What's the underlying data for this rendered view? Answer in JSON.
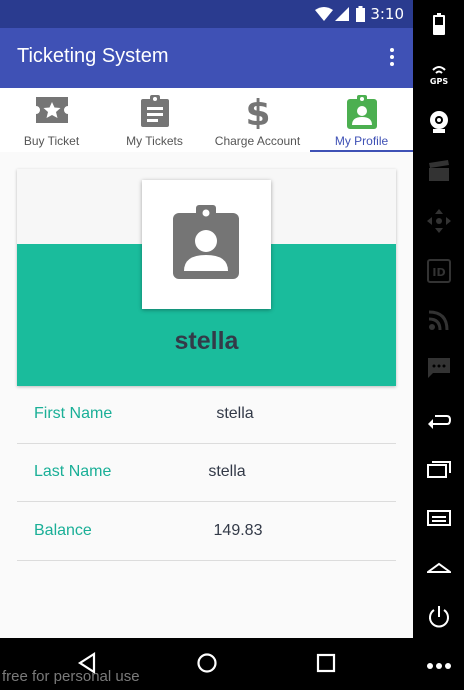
{
  "status": {
    "time": "3:10"
  },
  "app": {
    "title": "Ticketing System"
  },
  "tabs": [
    {
      "label": "Buy Ticket",
      "icon": "ticket-star-icon"
    },
    {
      "label": "My Tickets",
      "icon": "clipboard-list-icon"
    },
    {
      "label": "Charge Account",
      "icon": "dollar-icon"
    },
    {
      "label": "My Profile",
      "icon": "badge-person-icon",
      "active": true
    }
  ],
  "profile": {
    "username": "stella",
    "fields": [
      {
        "key": "First Name",
        "value": "stella"
      },
      {
        "key": "Last Name",
        "value": "stella"
      },
      {
        "key": "Balance",
        "value": "149.83"
      }
    ]
  },
  "watermark": "free for personal use",
  "colors": {
    "appbar": "#3f51b5",
    "statusbar": "#2a3b8f",
    "teal": "#1abc9c",
    "activeTabIcon": "#4caf50"
  },
  "side_toolbar": [
    "battery-icon",
    "gps-icon",
    "webcam-icon",
    "clapperboard-icon",
    "move-icon",
    "id-icon",
    "rss-icon",
    "sms-icon",
    "back-icon",
    "recents-icon",
    "menu-icon",
    "home-icon",
    "power-icon",
    "more-icon"
  ],
  "sideGps": "GPS",
  "sideId": "ID"
}
